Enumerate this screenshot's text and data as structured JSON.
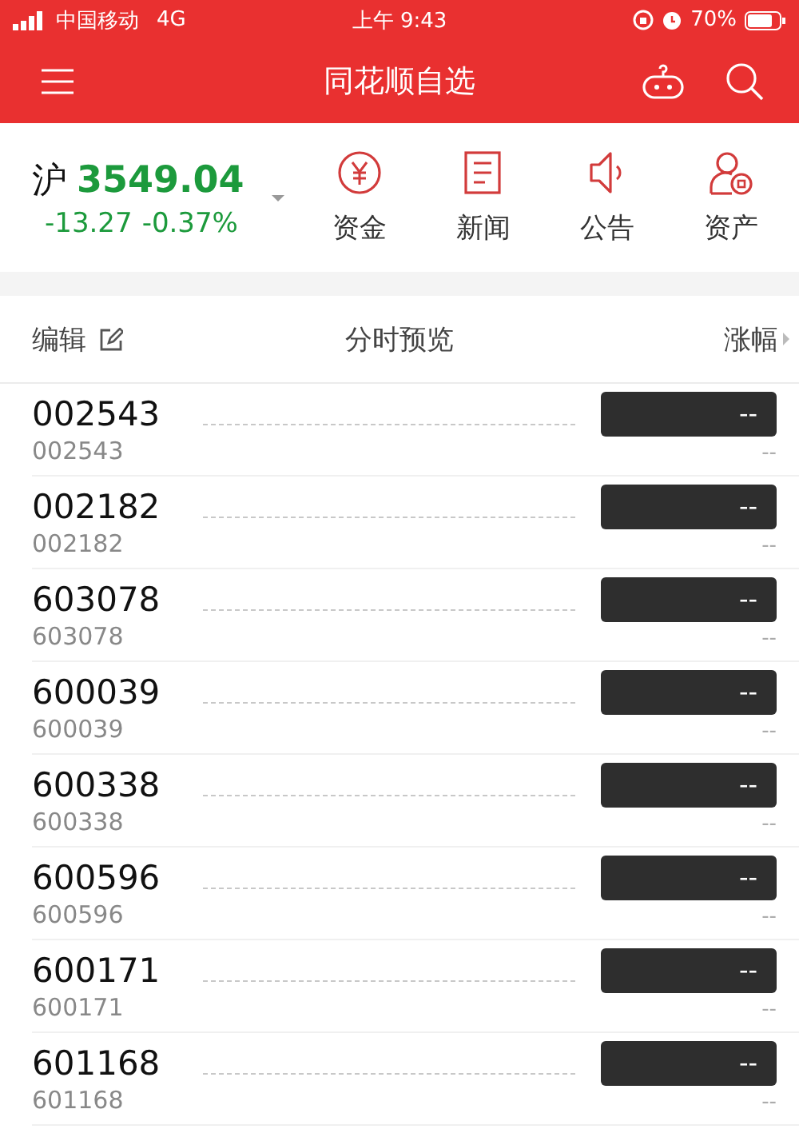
{
  "status_bar": {
    "carrier": "中国移动",
    "network": "4G",
    "time": "上午 9:43",
    "battery": "70%"
  },
  "nav": {
    "title": "同花顺自选"
  },
  "index": {
    "name": "沪",
    "value": "3549.04",
    "change": "-13.27",
    "percent": "-0.37%"
  },
  "shortcuts": [
    {
      "kind": "yuan",
      "label": "资金"
    },
    {
      "kind": "news",
      "label": "新闻"
    },
    {
      "kind": "speaker",
      "label": "公告"
    },
    {
      "kind": "person",
      "label": "资产"
    }
  ],
  "header": {
    "edit": "编辑",
    "preview": "分时预览",
    "change": "涨幅"
  },
  "rows": [
    {
      "code": "002543",
      "sub": "002543",
      "change": "--",
      "sub_change": "--"
    },
    {
      "code": "002182",
      "sub": "002182",
      "change": "--",
      "sub_change": "--"
    },
    {
      "code": "603078",
      "sub": "603078",
      "change": "--",
      "sub_change": "--"
    },
    {
      "code": "600039",
      "sub": "600039",
      "change": "--",
      "sub_change": "--"
    },
    {
      "code": "600338",
      "sub": "600338",
      "change": "--",
      "sub_change": "--"
    },
    {
      "code": "600596",
      "sub": "600596",
      "change": "--",
      "sub_change": "--"
    },
    {
      "code": "600171",
      "sub": "600171",
      "change": "--",
      "sub_change": "--"
    },
    {
      "code": "601168",
      "sub": "601168",
      "change": "--",
      "sub_change": "--"
    }
  ]
}
